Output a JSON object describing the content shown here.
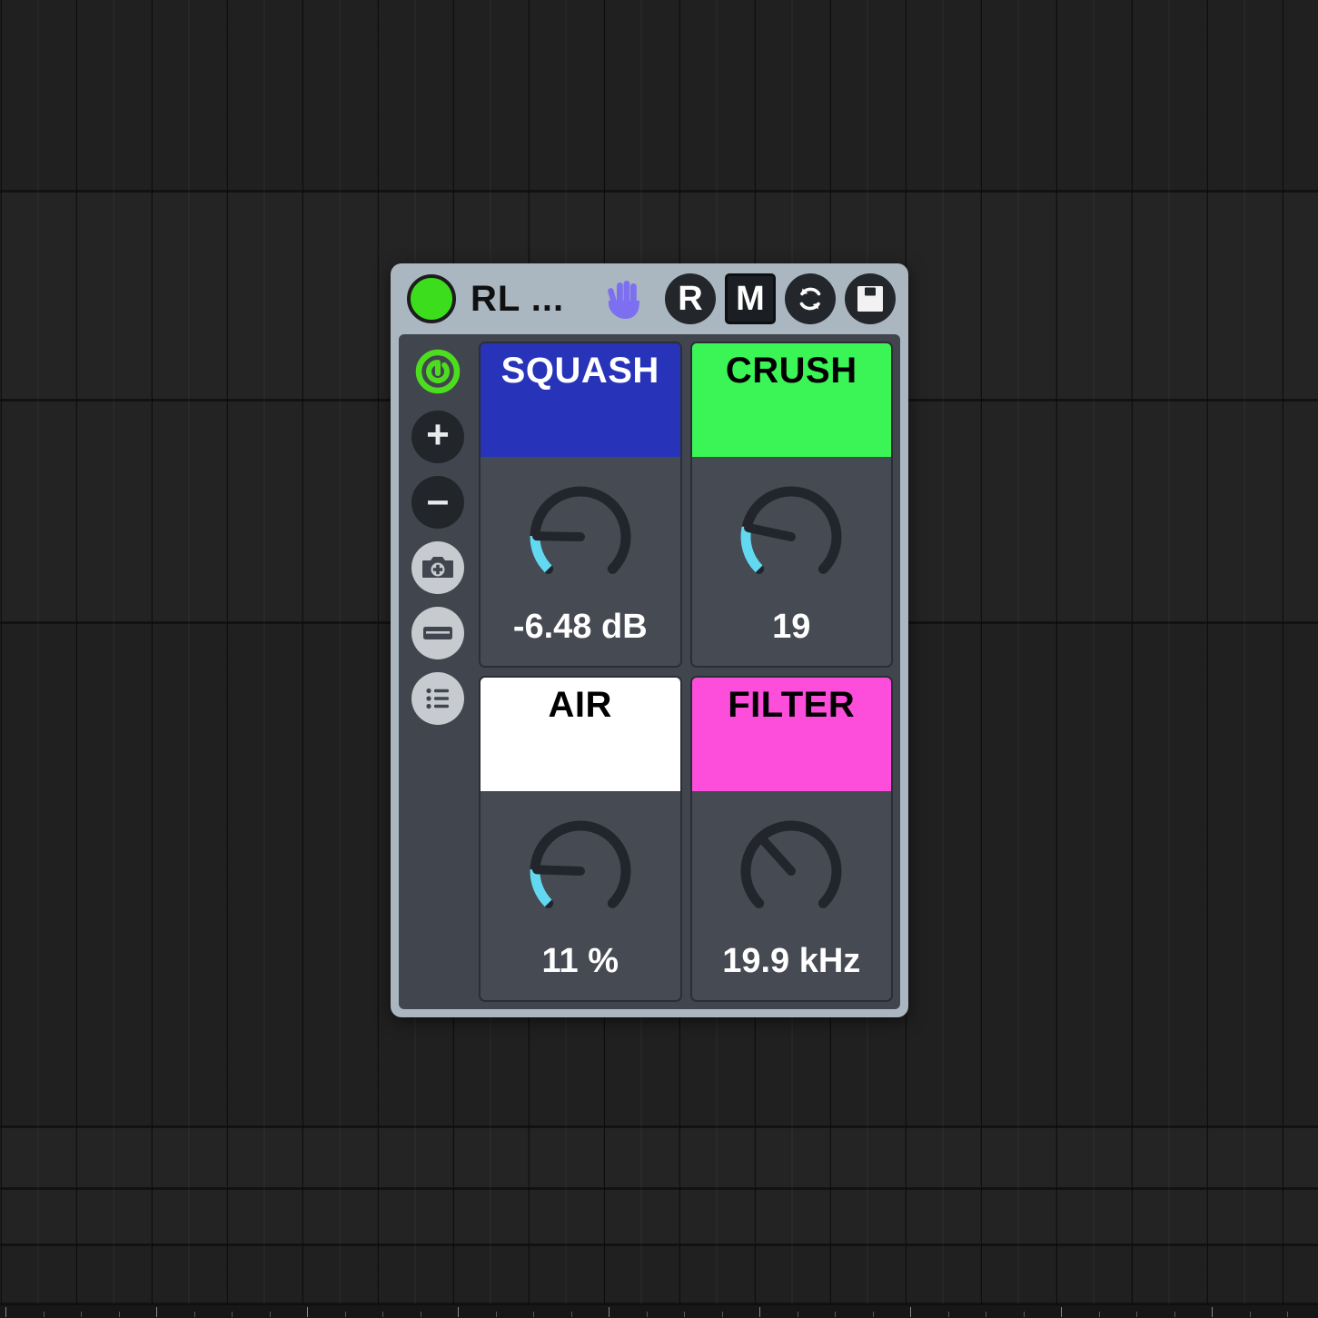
{
  "background": {
    "type": "daw-arrangement-grid",
    "track_rows": 6,
    "ruler_ticks": 35
  },
  "device": {
    "titlebar": {
      "power_state": "on",
      "power_color": "#3bdd1c",
      "name": "RL ...",
      "hand_icon_label": "raised-hand",
      "hand_color": "#7d70f0",
      "buttons": [
        {
          "id": "record-arm",
          "label": "R",
          "style": "round",
          "active": false
        },
        {
          "id": "map-mode",
          "label": "M",
          "style": "square",
          "active": true
        },
        {
          "id": "refresh",
          "label": "refresh-icon",
          "style": "round",
          "active": false
        },
        {
          "id": "save",
          "label": "save-icon",
          "style": "round",
          "active": false
        }
      ]
    },
    "sidebar": [
      {
        "id": "power",
        "icon": "power-icon",
        "style": "bare",
        "color": "#3bdd1c"
      },
      {
        "id": "add",
        "icon": "plus-icon",
        "style": "dark",
        "glyph": "+"
      },
      {
        "id": "remove",
        "icon": "minus-icon",
        "style": "dark",
        "glyph": "–"
      },
      {
        "id": "snapshot",
        "icon": "camera-plus-icon",
        "style": "light",
        "color": "#41454d"
      },
      {
        "id": "bank",
        "icon": "bank-icon",
        "style": "light",
        "color": "#41454d"
      },
      {
        "id": "list",
        "icon": "list-icon",
        "style": "light",
        "color": "#41454d"
      }
    ],
    "modules": [
      {
        "id": "squash",
        "title": "SQUASH",
        "header_bg": "#2733b8",
        "header_fg": "#ffffff",
        "value": "-6.48 dB",
        "knob": {
          "angle_deg": 181,
          "arc": true,
          "arc_color": "#62d9f0"
        }
      },
      {
        "id": "crush",
        "title": "CRUSH",
        "header_bg": "#3bf556",
        "header_fg": "#000000",
        "value": "19",
        "knob": {
          "angle_deg": 192,
          "arc": true,
          "arc_color": "#62d9f0"
        }
      },
      {
        "id": "air",
        "title": "AIR",
        "header_bg": "#ffffff",
        "header_fg": "#000000",
        "value": "11 %",
        "knob": {
          "angle_deg": 182,
          "arc": true,
          "arc_color": "#62d9f0"
        }
      },
      {
        "id": "filter",
        "title": "FILTER",
        "header_bg": "#fc4ddb",
        "header_fg": "#000000",
        "value": "19.9 kHz",
        "knob": {
          "angle_deg": 228,
          "arc": false,
          "arc_color": "#62d9f0"
        }
      }
    ]
  }
}
